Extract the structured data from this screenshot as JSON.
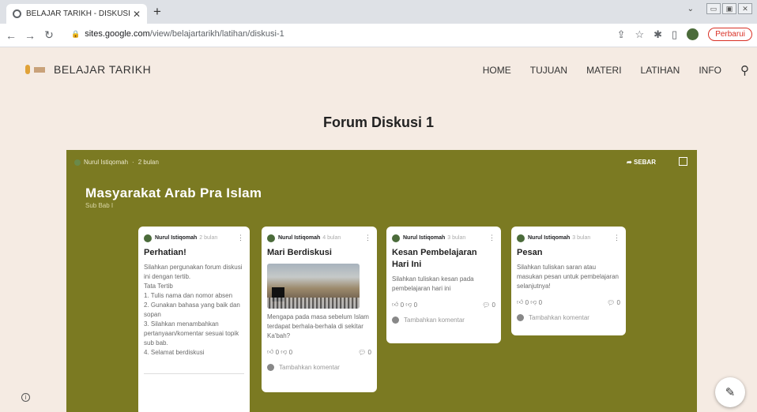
{
  "browser": {
    "tab_title": "BELAJAR TARIKH - DISKUSI 1",
    "new_tab": "+",
    "url_domain": "sites.google.com",
    "url_path": "/view/belajartarikh/latihan/diskusi-1",
    "update_label": "Perbarui"
  },
  "site": {
    "title": "BELAJAR TARIKH",
    "nav": [
      "HOME",
      "TUJUAN",
      "MATERI",
      "LATIHAN",
      "INFO"
    ]
  },
  "page": {
    "title": "Forum Diskusi 1"
  },
  "padlet": {
    "author": "Nurul Istiqomah",
    "time": "2 bulan",
    "share_label": "SEBAR",
    "title": "Masyarakat Arab Pra Islam",
    "subtitle": "Sub Bab I",
    "cards": [
      {
        "author": "Nurul Istiqomah",
        "time": "2 bulan",
        "title": "Perhatian!",
        "body": "Silahkan pergunakan forum diskusi ini dengan tertib.\nTata Tertib\n1. Tulis nama dan nomor absen\n2. Gunakan bahasa yang baik dan sopan\n3. Silahkan menambahkan pertanyaan/komentar sesuai topik sub bab.\n4. Selamat berdiskusi"
      },
      {
        "author": "Nurul Istiqomah",
        "time": "4 bulan",
        "title": "Mari Berdiskusi",
        "body": "Mengapa pada masa sebelum Islam terdapat berhala-berhala di sekitar Ka'bah?",
        "likes": "0",
        "dislikes": "0",
        "comments": "0",
        "comment_placeholder": "Tambahkan komentar"
      },
      {
        "author": "Nurul Istiqomah",
        "time": "3 bulan",
        "title": "Kesan Pembelajaran Hari Ini",
        "body": "Silahkan tuliskan kesan pada pembelajaran hari ini",
        "likes": "0",
        "dislikes": "0",
        "comments": "0",
        "comment_placeholder": "Tambahkan komentar"
      },
      {
        "author": "Nurul Istiqomah",
        "time": "3 bulan",
        "title": "Pesan",
        "body": "Silahkan tuliskan saran atau masukan pesan untuk pembelajaran selanjutnya!",
        "likes": "0",
        "dislikes": "0",
        "comments": "0",
        "comment_placeholder": "Tambahkan komentar"
      }
    ]
  },
  "colors": {
    "page_bg": "#F5EBE3",
    "padlet_bg": "#7B7A22",
    "accent_red": "#D93025"
  },
  "icons": [
    "globe-icon",
    "close-icon",
    "back-icon",
    "forward-icon",
    "reload-icon",
    "lock-icon",
    "share-page-icon",
    "star-icon",
    "extensions-icon",
    "sidepanel-icon",
    "search-icon",
    "expand-icon",
    "more-icon",
    "like-icon",
    "dislike-icon",
    "comment-icon",
    "info-icon",
    "edit-pencil-icon"
  ]
}
